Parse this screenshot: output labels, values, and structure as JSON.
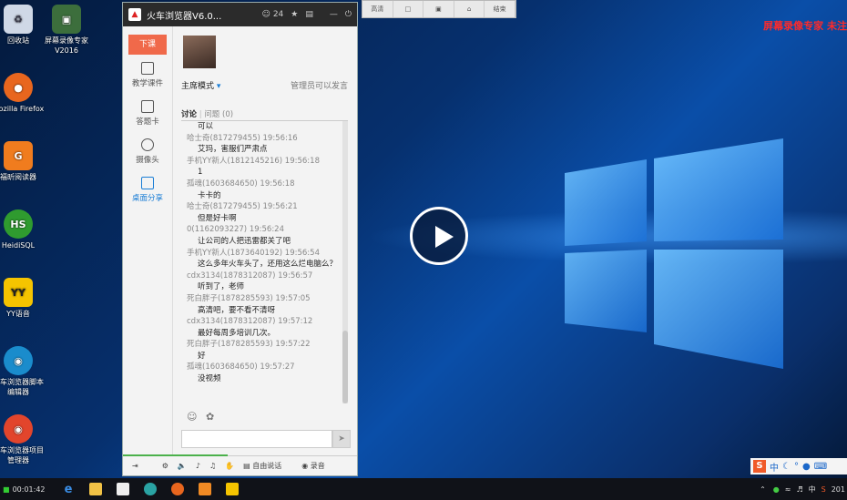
{
  "desktop": {
    "icons": [
      {
        "label": "回收站",
        "glyph": "recycle-bin-icon",
        "color": "#cfd8e6"
      },
      {
        "label": "屏幕录像专家V2016",
        "glyph": "film-camera-icon",
        "color": "#3c6e3c"
      },
      {
        "label": "Mozilla Firefox",
        "glyph": "firefox-icon",
        "color": "#e8661e"
      },
      {
        "label": "福昕阅读器",
        "glyph": "pdf-reader-icon",
        "color": "#f07c1e"
      },
      {
        "label": "HeidiSQL",
        "glyph": "heidisql-icon",
        "color": "#2f9b2f"
      },
      {
        "label": "YY语音",
        "glyph": "yy-icon",
        "color": "#f5c400"
      },
      {
        "label": "火车浏览器脚本编辑器",
        "glyph": "train-browser-script-icon",
        "color": "#1a8ccc"
      },
      {
        "label": "火车浏览器项目管理器",
        "glyph": "train-browser-project-icon",
        "color": "#e2452c"
      }
    ],
    "watermark": "屏幕录像专家  未注",
    "float_toolbar": [
      "高清",
      "",
      "",
      "",
      "结束"
    ]
  },
  "chat": {
    "title": "火车浏览器V6.0...",
    "user_count": "24",
    "end_class": "下课",
    "side": [
      {
        "label": "教学课件"
      },
      {
        "label": "答题卡"
      },
      {
        "label": "摄像头"
      },
      {
        "label": "桌面分享"
      }
    ],
    "mode": "主席模式",
    "admin_note": "管理员可以发言",
    "tab_discuss": "讨论",
    "tab_questions": "问题",
    "question_count": "(0)",
    "messages": [
      {
        "text": "可以"
      },
      {
        "who": "哈士奇(817279455) 19:56:16",
        "text": "艾玛，害服们严肃点"
      },
      {
        "who": "手机YY新人(1812145216) 19:56:18",
        "text": "1"
      },
      {
        "who": "孤魂(1603684650) 19:56:18",
        "text": "卡卡的"
      },
      {
        "who": "哈士奇(817279455) 19:56:21",
        "text": "但是好卡啊"
      },
      {
        "who": "0(1162093227) 19:56:24",
        "text": "让公司的人把迅雷都关了吧"
      },
      {
        "who": "手机YY新人(1873640192) 19:56:54",
        "text": "这么多年火车头了，还用这么烂电脑么？"
      },
      {
        "who": "cdx3134(1878312087) 19:56:57",
        "text": "听到了，老师"
      },
      {
        "who": "死白胖子(1878285593) 19:57:05",
        "text": "高清吧，要不看不清呀"
      },
      {
        "who": "cdx3134(1878312087) 19:57:12",
        "text": "最好每周多培训几次。"
      },
      {
        "who": "死白胖子(1878285593) 19:57:22",
        "text": "好"
      },
      {
        "who": "孤魂(1603684650) 19:57:27",
        "text": "没视频"
      }
    ],
    "bottom": {
      "free_talk": "自由说话",
      "record": "录音"
    }
  },
  "taskbar": {
    "time": "00:01:42",
    "tray_date": "201",
    "ime_text": "中"
  }
}
